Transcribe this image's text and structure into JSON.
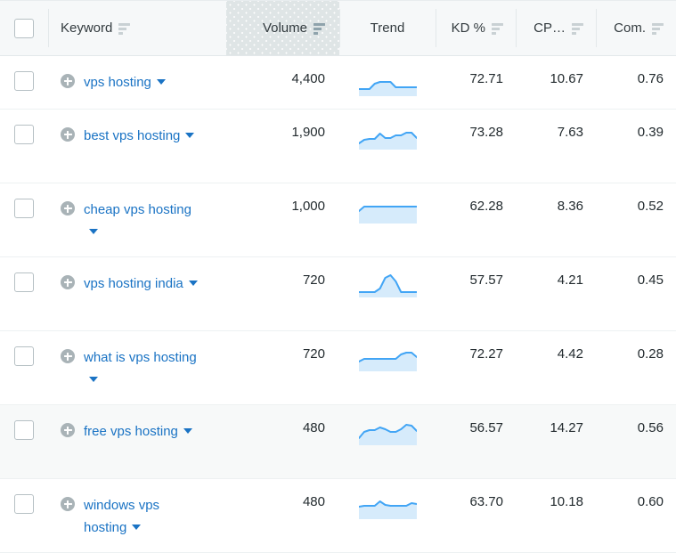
{
  "table": {
    "columns": [
      {
        "key": "checkbox",
        "label": "",
        "sortable": false,
        "active": false
      },
      {
        "key": "keyword",
        "label": "Keyword",
        "sortable": true,
        "active": false
      },
      {
        "key": "volume",
        "label": "Volume",
        "sortable": true,
        "active": true
      },
      {
        "key": "trend",
        "label": "Trend",
        "sortable": false,
        "active": false
      },
      {
        "key": "kd",
        "label": "KD %",
        "sortable": true,
        "active": false
      },
      {
        "key": "cpc",
        "label": "CP…",
        "sortable": true,
        "active": false
      },
      {
        "key": "com",
        "label": "Com.",
        "sortable": true,
        "active": false
      }
    ],
    "rows": [
      {
        "keyword": "vps hosting",
        "volume": "4,400",
        "kd": "72.71",
        "cpc": "10.67",
        "com": "0.76",
        "checked": false,
        "hovered": false,
        "trend_points": [
          20,
          20,
          20,
          14,
          12,
          12,
          12,
          18,
          18,
          18,
          18,
          18
        ]
      },
      {
        "keyword": "best vps hosting",
        "volume": "1,900",
        "kd": "73.28",
        "cpc": "7.63",
        "com": "0.39",
        "checked": false,
        "hovered": false,
        "trend_points": [
          21,
          17,
          16,
          16,
          10,
          15,
          15,
          12,
          12,
          9,
          9,
          15
        ]
      },
      {
        "keyword": "cheap vps hosting",
        "volume": "1,000",
        "kd": "62.28",
        "cpc": "8.36",
        "com": "0.52",
        "checked": false,
        "hovered": false,
        "trend_points": [
          14,
          9,
          9,
          9,
          9,
          9,
          9,
          9,
          9,
          9,
          9,
          9
        ]
      },
      {
        "keyword": "vps hosting india",
        "volume": "720",
        "kd": "57.57",
        "cpc": "4.21",
        "com": "0.45",
        "checked": false,
        "hovered": false,
        "trend_points": [
          22,
          22,
          22,
          22,
          18,
          6,
          3,
          10,
          22,
          22,
          22,
          22
        ]
      },
      {
        "keyword": "what is vps hosting",
        "volume": "720",
        "kd": "72.27",
        "cpc": "4.42",
        "com": "0.28",
        "checked": false,
        "hovered": false,
        "trend_points": [
          17,
          14,
          14,
          14,
          14,
          14,
          14,
          14,
          9,
          7,
          7,
          12
        ]
      },
      {
        "keyword": "free vps hosting",
        "volume": "480",
        "kd": "56.57",
        "cpc": "14.27",
        "com": "0.56",
        "checked": false,
        "hovered": true,
        "trend_points": [
          20,
          13,
          11,
          11,
          8,
          10,
          13,
          13,
          10,
          5,
          6,
          12
        ]
      },
      {
        "keyword": "windows vps hosting",
        "volume": "480",
        "kd": "63.70",
        "cpc": "10.18",
        "com": "0.60",
        "checked": false,
        "hovered": false,
        "trend_points": [
          14,
          13,
          13,
          13,
          8,
          12,
          13,
          13,
          13,
          13,
          10,
          11
        ]
      }
    ]
  },
  "colors": {
    "link": "#1a73c4",
    "spark_stroke": "#42a5f5",
    "spark_fill": "#d6ebfb",
    "header_bg": "#f6f8f9",
    "header_active_bg": "#dfe5e6",
    "row_hover_bg": "#f7f9f9",
    "add_button": "#a9b3b7",
    "border": "#edf1f2"
  },
  "icons": {
    "sort": "sort-descending-icon",
    "add": "plus-circle-icon",
    "expand": "chevron-down-icon",
    "checkbox": "checkbox-icon"
  }
}
